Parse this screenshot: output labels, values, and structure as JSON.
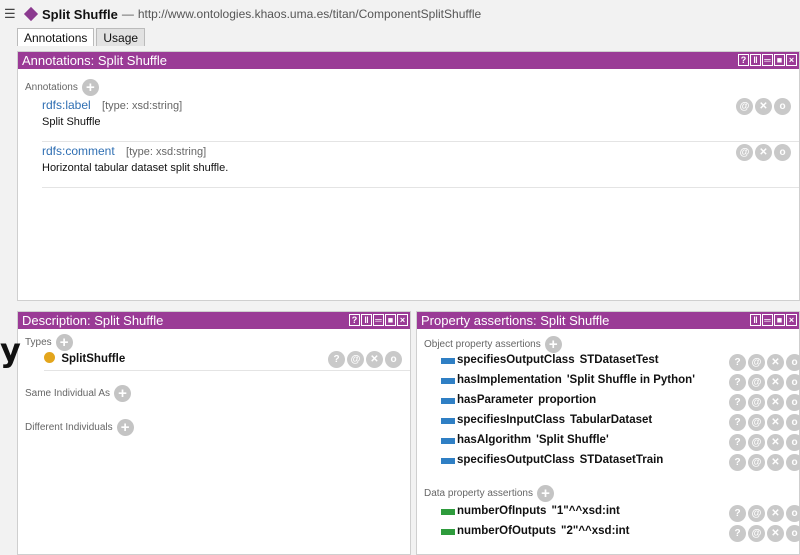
{
  "window": {
    "entity_name": "Split Shuffle",
    "separator": "—",
    "url": "http://www.ontologies.khaos.uma.es/titan/ComponentSplitShuffle"
  },
  "tabs": [
    {
      "label": "Annotations",
      "active": true
    },
    {
      "label": "Usage",
      "active": false
    }
  ],
  "annotations_panel": {
    "title": "Annotations: Split Shuffle",
    "section_label": "Annotations",
    "items": [
      {
        "property": "rdfs:label",
        "type": "[type: xsd:string]",
        "value": "Split Shuffle"
      },
      {
        "property": "rdfs:comment",
        "type": "[type: xsd:string]",
        "value": "Horizontal tabular dataset split shuffle."
      }
    ]
  },
  "description_panel": {
    "title": "Description: Split Shuffle",
    "types_label": "Types",
    "types": [
      "SplitShuffle"
    ],
    "same_individual_label": "Same Individual As",
    "different_individuals_label": "Different Individuals"
  },
  "property_panel": {
    "title": "Property assertions: Split Shuffle",
    "object_label": "Object property assertions",
    "object_assertions": [
      {
        "property": "specifiesOutputClass",
        "value": "STDatasetTest"
      },
      {
        "property": "hasImplementation",
        "value": "'Split Shuffle in Python'"
      },
      {
        "property": "hasParameter",
        "value": "proportion"
      },
      {
        "property": "specifiesInputClass",
        "value": "TabularDataset"
      },
      {
        "property": "hasAlgorithm",
        "value": "'Split Shuffle'"
      },
      {
        "property": "specifiesOutputClass",
        "value": "STDatasetTrain"
      }
    ],
    "data_label": "Data property assertions",
    "data_assertions": [
      {
        "property": "numberOfInputs",
        "value": "\"1\"^^xsd:int"
      },
      {
        "property": "numberOfOutputs",
        "value": "\"2\"^^xsd:int"
      }
    ]
  },
  "misc": {
    "overlay_letter": "y"
  },
  "colors": {
    "header": "#9a3b96",
    "object_prop": "#2f7fc4",
    "data_prop": "#2e9b3c",
    "individual": "#e3a51c",
    "link": "#2f6fb3"
  }
}
